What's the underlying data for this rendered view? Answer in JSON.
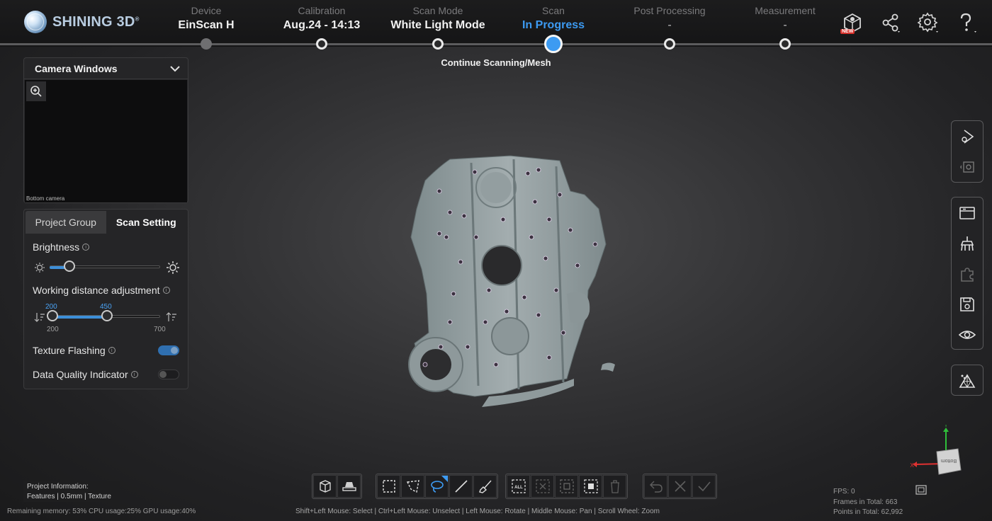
{
  "app": {
    "brand": "SHINING 3D",
    "brand_mark": "®"
  },
  "steps": [
    {
      "label": "Device",
      "value": "EinScan H",
      "state": "done"
    },
    {
      "label": "Calibration",
      "value": "Aug.24 - 14:13",
      "state": "next"
    },
    {
      "label": "Scan Mode",
      "value": "White Light Mode",
      "state": "next"
    },
    {
      "label": "Scan",
      "value": "In Progress",
      "state": "active"
    },
    {
      "label": "Post Processing",
      "value": "-",
      "state": "next"
    },
    {
      "label": "Measurement",
      "value": "-",
      "state": "next"
    }
  ],
  "step_sub": "Continue Scanning/Mesh",
  "top_icons": {
    "new_badge": "NEW",
    "items": [
      "model-new-icon",
      "share-icon",
      "settings-icon",
      "help-icon"
    ]
  },
  "camera": {
    "title": "Camera Windows",
    "label": "Bottom camera"
  },
  "settings": {
    "tabs": [
      "Project Group",
      "Scan Setting"
    ],
    "brightness": {
      "label": "Brightness",
      "level": 0.18
    },
    "working_distance": {
      "label": "Working distance adjustment",
      "min": "200",
      "max": "700",
      "range_low": "200",
      "range_high": "450"
    },
    "texture_flashing": {
      "label": "Texture Flashing",
      "on": true
    },
    "data_quality": {
      "label": "Data Quality Indicator",
      "on": false
    }
  },
  "right_toolbar": {
    "group1": [
      "scan-play-icon",
      "scan-settings-icon"
    ],
    "group2": [
      "window-icon",
      "clean-brush-icon",
      "puzzle-icon",
      "save-icon",
      "eye-icon"
    ],
    "group3": [
      "mesh-triangle-icon"
    ]
  },
  "bottom_toolbar": {
    "all_label": "ALL"
  },
  "project_info": {
    "title": "Project Information:",
    "details": "Features | 0.5mm | Texture"
  },
  "status": "Remaining memory: 53% CPU usage:25%  GPU usage:40%",
  "hint": "Shift+Left Mouse: Select | Ctrl+Left Mouse: Unselect | Left Mouse: Rotate | Middle Mouse: Pan | Scroll Wheel: Zoom",
  "stats": {
    "fps": "FPS: 0",
    "frames": "Frames in Total: 663",
    "points": "Points in Total: 62,992"
  },
  "axis": {
    "x": "X",
    "y": "Y",
    "cube_face": "Bottom"
  },
  "colors": {
    "accent": "#3d9bf2",
    "background": "#2b2b2d"
  }
}
